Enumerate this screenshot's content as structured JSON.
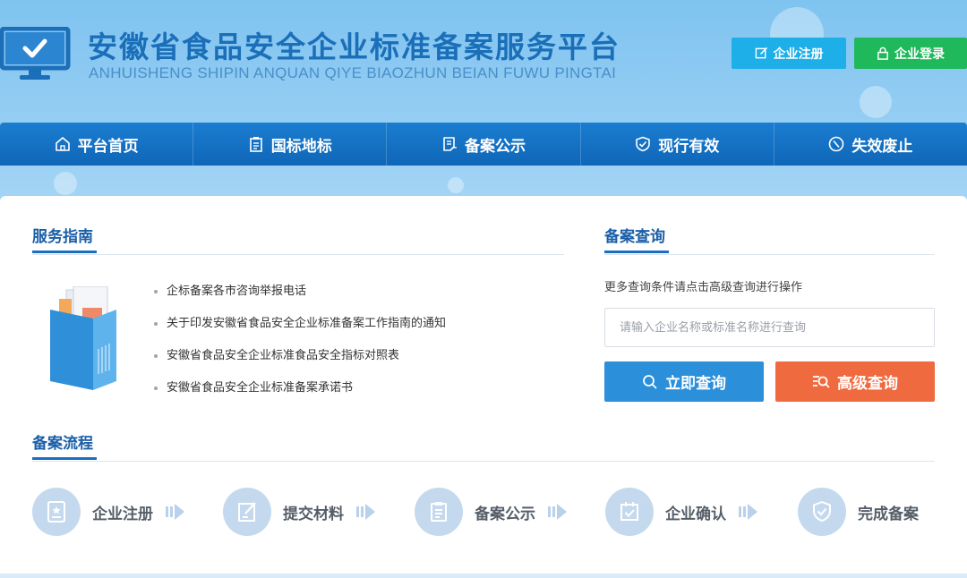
{
  "header": {
    "title_cn": "安徽省食品安全企业标准备案服务平台",
    "title_en": "ANHUISHENG SHIPIN ANQUAN QIYE BIAOZHUN BEIAN FUWU PINGTAI",
    "register_label": "企业注册",
    "login_label": "企业登录",
    "register_icon": "edit-square-icon",
    "login_icon": "lock-icon",
    "register_color": "#1eaee8",
    "login_color": "#1fb85a"
  },
  "nav": {
    "items": [
      {
        "label": "平台首页",
        "icon": "home-icon"
      },
      {
        "label": "国标地标",
        "icon": "clipboard-icon"
      },
      {
        "label": "备案公示",
        "icon": "document-icon"
      },
      {
        "label": "现行有效",
        "icon": "shield-check-icon"
      },
      {
        "label": "失效废止",
        "icon": "ban-icon"
      }
    ],
    "color": "#1270c2"
  },
  "guide": {
    "title": "服务指南",
    "items": [
      "企标备案各市咨询举报电话",
      "关于印发安徽省食品安全企业标准备案工作指南的通知",
      "安徽省食品安全企业标准食品安全指标对照表",
      "安徽省食品安全企业标准备案承诺书"
    ]
  },
  "query": {
    "title": "备案查询",
    "hint": "更多查询条件请点击高级查询进行操作",
    "placeholder": "请输入企业名称或标准名称进行查询",
    "value": "",
    "search_now_label": "立即查询",
    "advanced_label": "高级查询",
    "search_now_color": "#2b8fd9",
    "advanced_color": "#ef6a3f"
  },
  "process": {
    "title": "备案流程",
    "steps": [
      {
        "label": "企业注册",
        "icon": "id-badge-icon"
      },
      {
        "label": "提交材料",
        "icon": "edit-document-icon"
      },
      {
        "label": "备案公示",
        "icon": "list-document-icon"
      },
      {
        "label": "企业确认",
        "icon": "calendar-check-icon"
      },
      {
        "label": "完成备案",
        "icon": "shield-check-icon"
      }
    ]
  }
}
